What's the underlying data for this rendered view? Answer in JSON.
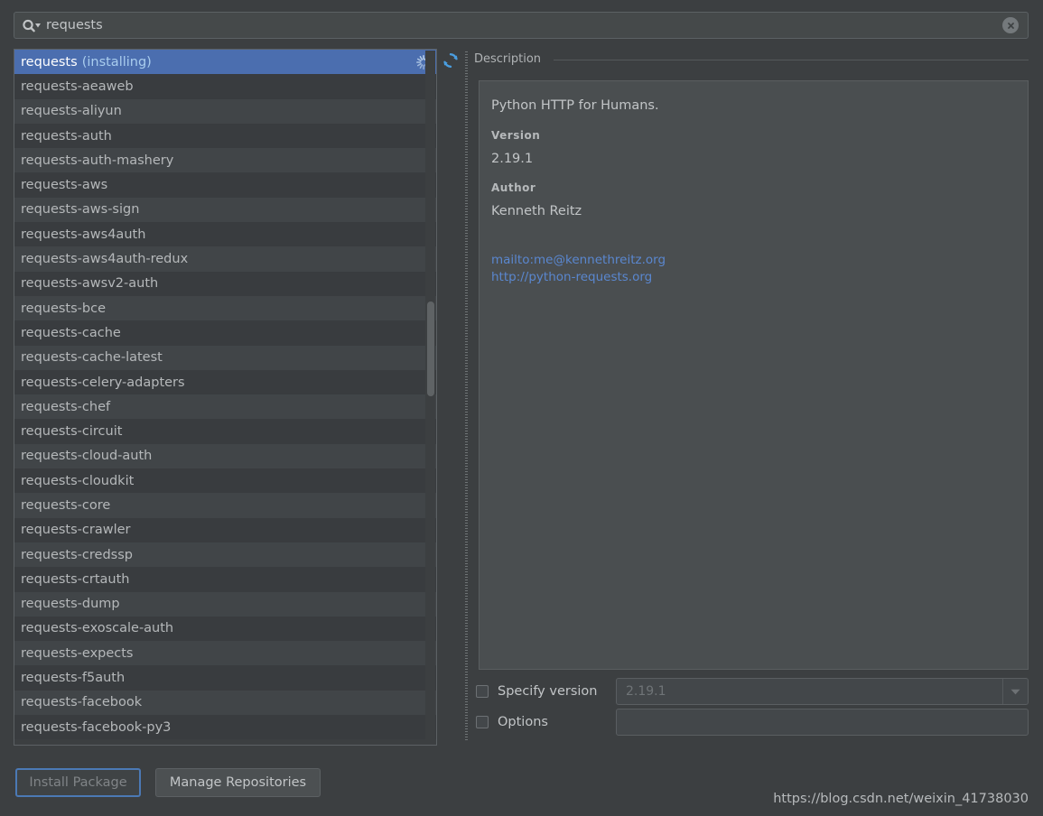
{
  "search": {
    "value": "requests",
    "placeholder": "Search packages",
    "search_icon": "search-icon",
    "dropdown_icon": "chevron-down-icon",
    "clear_icon": "clear-icon"
  },
  "package_list": {
    "selected_index": 0,
    "items": [
      {
        "name": "requests",
        "suffix": "(installing)",
        "selected": true,
        "loading": true
      },
      {
        "name": "requests-aeaweb"
      },
      {
        "name": "requests-aliyun"
      },
      {
        "name": "requests-auth"
      },
      {
        "name": "requests-auth-mashery"
      },
      {
        "name": "requests-aws"
      },
      {
        "name": "requests-aws-sign"
      },
      {
        "name": "requests-aws4auth"
      },
      {
        "name": "requests-aws4auth-redux"
      },
      {
        "name": "requests-awsv2-auth"
      },
      {
        "name": "requests-bce"
      },
      {
        "name": "requests-cache"
      },
      {
        "name": "requests-cache-latest"
      },
      {
        "name": "requests-celery-adapters"
      },
      {
        "name": "requests-chef"
      },
      {
        "name": "requests-circuit"
      },
      {
        "name": "requests-cloud-auth"
      },
      {
        "name": "requests-cloudkit"
      },
      {
        "name": "requests-core"
      },
      {
        "name": "requests-crawler"
      },
      {
        "name": "requests-credssp"
      },
      {
        "name": "requests-crtauth"
      },
      {
        "name": "requests-dump"
      },
      {
        "name": "requests-exoscale-auth"
      },
      {
        "name": "requests-expects"
      },
      {
        "name": "requests-f5auth"
      },
      {
        "name": "requests-facebook"
      },
      {
        "name": "requests-facebook-py3"
      }
    ]
  },
  "refresh": {
    "icon": "refresh-icon",
    "tooltip": "Reload List of Packages"
  },
  "description": {
    "group_title": "Description",
    "summary": "Python HTTP for Humans.",
    "version_label": "Version",
    "version_value": "2.19.1",
    "author_label": "Author",
    "author_value": "Kenneth Reitz",
    "links": [
      "mailto:me@kennethreitz.org",
      "http://python-requests.org"
    ]
  },
  "form": {
    "specify_version": {
      "label": "Specify version",
      "checked": false,
      "value": "2.19.1",
      "arrow_icon": "dropdown-arrow-icon"
    },
    "options": {
      "label": "Options",
      "checked": false,
      "value": "",
      "placeholder": ""
    }
  },
  "footer": {
    "install_label": "Install Package",
    "install_enabled": false,
    "manage_label": "Manage Repositories"
  },
  "watermark": "https://blog.csdn.net/weixin_41738030",
  "colors": {
    "window_bg": "#3c3f41",
    "selection_blue": "#4b6eaf",
    "link_blue": "#5a87cf",
    "accent_cyan": "#579ee0",
    "row_odd": "#414548",
    "row_even": "#393c3f",
    "desc_bg": "#4a4e50",
    "text": "#c2c5c7"
  }
}
